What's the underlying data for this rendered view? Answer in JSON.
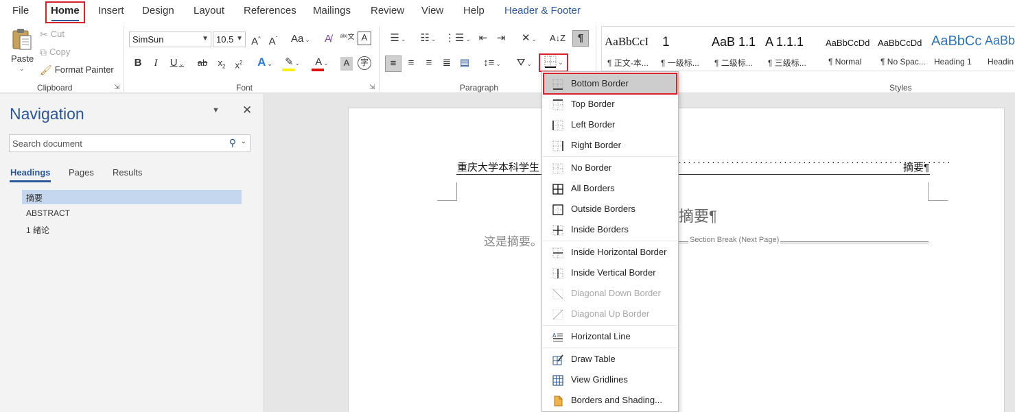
{
  "tabs": [
    "File",
    "Home",
    "Insert",
    "Design",
    "Layout",
    "References",
    "Mailings",
    "Review",
    "View",
    "Help",
    "Header & Footer"
  ],
  "clipboard": {
    "group_label": "Clipboard",
    "paste": "Paste",
    "cut": "Cut",
    "copy": "Copy",
    "format_painter": "Format Painter"
  },
  "font": {
    "group_label": "Font",
    "font_name": "SimSun",
    "font_size": "10.5"
  },
  "paragraph": {
    "group_label": "Paragraph"
  },
  "styles": {
    "group_label": "Styles",
    "items": [
      {
        "preview": "AaBbCcI",
        "name": "¶ 正文-本..."
      },
      {
        "preview": "1",
        "name": "¶ 一级标..."
      },
      {
        "preview": "AaB 1.1",
        "name": "¶ 二级标..."
      },
      {
        "preview": "A 1.1.1",
        "name": "¶ 三级标..."
      },
      {
        "preview": "AaBbCcDd",
        "name": "¶ Normal"
      },
      {
        "preview": "AaBbCcDd",
        "name": "¶ No Spac..."
      },
      {
        "preview": "AaBbCc",
        "name": "Heading 1"
      },
      {
        "preview": "AaBbC",
        "name": "Headin"
      }
    ]
  },
  "navigation": {
    "title": "Navigation",
    "search_placeholder": "Search document",
    "tabs": [
      "Headings",
      "Pages",
      "Results"
    ],
    "headings": [
      "摘要",
      "ABSTRACT",
      "1 绪论"
    ]
  },
  "document": {
    "header_left": "重庆大学本科学生",
    "header_right": "摘要¶",
    "heading": "摘要¶",
    "body": "这是摘要。",
    "section_break": "Section Break (Next Page)"
  },
  "border_menu": {
    "items": [
      "Bottom Border",
      "Top Border",
      "Left Border",
      "Right Border",
      "No Border",
      "All Borders",
      "Outside Borders",
      "Inside Borders",
      "Inside Horizontal Border",
      "Inside Vertical Border",
      "Diagonal Down Border",
      "Diagonal Up Border",
      "Horizontal Line",
      "Draw Table",
      "View Gridlines",
      "Borders and Shading..."
    ]
  },
  "colors": {
    "accent": "#2b579a",
    "highlight_red": "#d9212c"
  }
}
